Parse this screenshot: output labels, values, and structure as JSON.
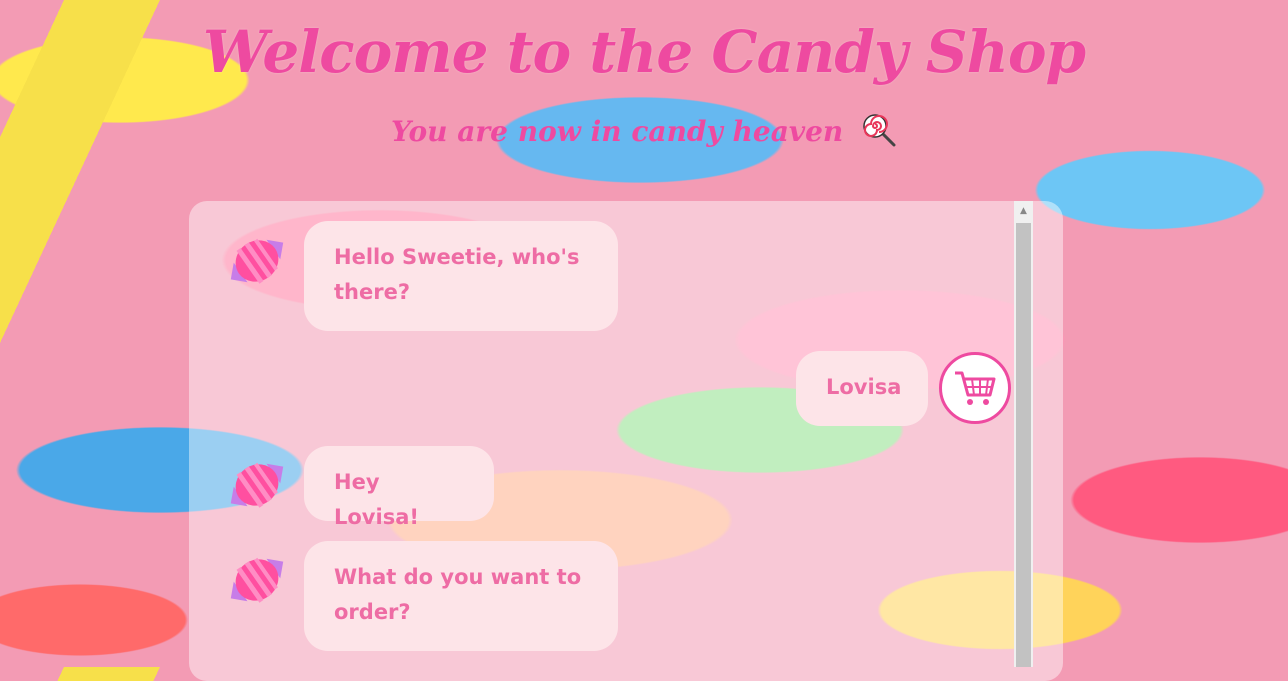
{
  "header": {
    "title": "Welcome to the Candy Shop",
    "subtitle": "You are now in candy heaven"
  },
  "icons": {
    "lollipop": "lollipop-icon",
    "bot_avatar": "candy-icon",
    "user_avatar": "shopping-cart-icon"
  },
  "colors": {
    "title": "#ee4aa0",
    "bubble_bg": "#fde4e8",
    "bubble_text": "#ee6ca4"
  },
  "messages": [
    {
      "sender": "bot",
      "text": "Hello Sweetie, who's there?"
    },
    {
      "sender": "user",
      "text": "Lovisa"
    },
    {
      "sender": "bot",
      "text": "Hey Lovisa!"
    },
    {
      "sender": "bot",
      "text": "What do you want to order?"
    }
  ]
}
